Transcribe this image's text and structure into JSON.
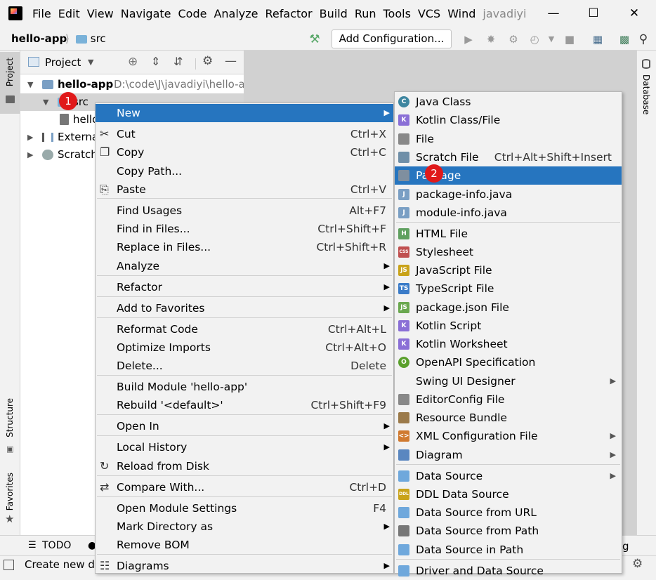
{
  "menubar": {
    "items": [
      "File",
      "Edit",
      "View",
      "Navigate",
      "Code",
      "Analyze",
      "Refactor",
      "Build",
      "Run",
      "Tools",
      "VCS",
      "Wind"
    ],
    "title_fragment": "javadiyi"
  },
  "navbar": {
    "project": "hello-app",
    "folder": "src",
    "add_config": "Add Configuration..."
  },
  "project_panel": {
    "title": "Project",
    "root": {
      "name": "hello-app",
      "path": "D:\\code\\J\\javadiyi\\hello-a"
    },
    "src": "src",
    "file": "hello",
    "external": "Externa",
    "scratch": "Scratch"
  },
  "side_tabs": {
    "project": "Project",
    "structure": "Structure",
    "favorites": "Favorites",
    "database": "Database"
  },
  "bottom": {
    "todo": "TODO",
    "status": "Create new di",
    "right_fragment": "g"
  },
  "badges": {
    "one": "1",
    "two": "2"
  },
  "context_menu": [
    {
      "label": "New",
      "shortcut": "",
      "submenu": true,
      "highlight": true
    },
    {
      "label": "Cut",
      "shortcut": "Ctrl+X",
      "icon": "scissors-icon"
    },
    {
      "label": "Copy",
      "shortcut": "Ctrl+C",
      "icon": "copy-icon"
    },
    {
      "label": "Copy Path...",
      "shortcut": ""
    },
    {
      "label": "Paste",
      "shortcut": "Ctrl+V",
      "icon": "paste-icon"
    },
    {
      "label": "Find Usages",
      "shortcut": "Alt+F7"
    },
    {
      "label": "Find in Files...",
      "shortcut": "Ctrl+Shift+F"
    },
    {
      "label": "Replace in Files...",
      "shortcut": "Ctrl+Shift+R"
    },
    {
      "label": "Analyze",
      "shortcut": "",
      "submenu": true
    },
    {
      "label": "Refactor",
      "shortcut": "",
      "submenu": true
    },
    {
      "label": "Add to Favorites",
      "shortcut": "",
      "submenu": true
    },
    {
      "label": "Reformat Code",
      "shortcut": "Ctrl+Alt+L"
    },
    {
      "label": "Optimize Imports",
      "shortcut": "Ctrl+Alt+O"
    },
    {
      "label": "Delete...",
      "shortcut": "Delete"
    },
    {
      "label": "Build Module 'hello-app'",
      "shortcut": ""
    },
    {
      "label": "Rebuild '<default>'",
      "shortcut": "Ctrl+Shift+F9"
    },
    {
      "label": "Open In",
      "shortcut": "",
      "submenu": true
    },
    {
      "label": "Local History",
      "shortcut": "",
      "submenu": true
    },
    {
      "label": "Reload from Disk",
      "shortcut": "",
      "icon": "reload-icon"
    },
    {
      "label": "Compare With...",
      "shortcut": "Ctrl+D",
      "icon": "compare-icon"
    },
    {
      "label": "Open Module Settings",
      "shortcut": "F4"
    },
    {
      "label": "Mark Directory as",
      "shortcut": "",
      "submenu": true
    },
    {
      "label": "Remove BOM",
      "shortcut": ""
    },
    {
      "label": "Diagrams",
      "shortcut": "",
      "submenu": true,
      "icon": "diagrams-icon"
    }
  ],
  "new_submenu": [
    {
      "label": "Java Class",
      "shortcut": "",
      "icon": "C",
      "color": "#3e86a0"
    },
    {
      "label": "Kotlin Class/File",
      "shortcut": "",
      "icon": "K",
      "color": "#8a6fd6"
    },
    {
      "label": "File",
      "shortcut": "",
      "icon": "",
      "color": "#888888"
    },
    {
      "label": "Scratch File",
      "shortcut": "Ctrl+Alt+Shift+Insert",
      "icon": "",
      "color": "#6f8fa8"
    },
    {
      "label": "Package",
      "shortcut": "",
      "icon": "",
      "color": "#7f8f9f",
      "highlight": true
    },
    {
      "label": "package-info.java",
      "shortcut": "",
      "icon": "J",
      "color": "#7a9fc4"
    },
    {
      "label": "module-info.java",
      "shortcut": "",
      "icon": "J",
      "color": "#7a9fc4"
    },
    {
      "label": "HTML File",
      "shortcut": "",
      "icon": "H",
      "color": "#60a060"
    },
    {
      "label": "Stylesheet",
      "shortcut": "",
      "icon": "CSS",
      "color": "#c05050"
    },
    {
      "label": "JavaScript File",
      "shortcut": "",
      "icon": "JS",
      "color": "#c9a31a"
    },
    {
      "label": "TypeScript File",
      "shortcut": "",
      "icon": "TS",
      "color": "#3a7bc8"
    },
    {
      "label": "package.json File",
      "shortcut": "",
      "icon": "JS",
      "color": "#6aa84f"
    },
    {
      "label": "Kotlin Script",
      "shortcut": "",
      "icon": "K",
      "color": "#8a6fd6"
    },
    {
      "label": "Kotlin Worksheet",
      "shortcut": "",
      "icon": "K",
      "color": "#8a6fd6"
    },
    {
      "label": "OpenAPI Specification",
      "shortcut": "",
      "icon": "O",
      "color": "#5aa02c"
    },
    {
      "label": "Swing UI Designer",
      "shortcut": "",
      "submenu": true
    },
    {
      "label": "EditorConfig File",
      "shortcut": "",
      "icon": "",
      "color": "#888888"
    },
    {
      "label": "Resource Bundle",
      "shortcut": "",
      "icon": "",
      "color": "#9b7a4a"
    },
    {
      "label": "XML Configuration File",
      "shortcut": "",
      "icon": "<>",
      "color": "#d07a30",
      "submenu": true
    },
    {
      "label": "Diagram",
      "shortcut": "",
      "icon": "",
      "color": "#5a87c0",
      "submenu": true
    },
    {
      "label": "Data Source",
      "shortcut": "",
      "icon": "",
      "color": "#6fa8dc",
      "submenu": true
    },
    {
      "label": "DDL Data Source",
      "shortcut": "",
      "icon": "DDL",
      "color": "#c9a31a"
    },
    {
      "label": "Data Source from URL",
      "shortcut": "",
      "icon": "",
      "color": "#6fa8dc"
    },
    {
      "label": "Data Source from Path",
      "shortcut": "",
      "icon": "",
      "color": "#777777"
    },
    {
      "label": "Data Source in Path",
      "shortcut": "",
      "icon": "",
      "color": "#6fa8dc"
    },
    {
      "label": "Driver and Data Source",
      "shortcut": "",
      "icon": "",
      "color": "#6fa8dc"
    }
  ]
}
